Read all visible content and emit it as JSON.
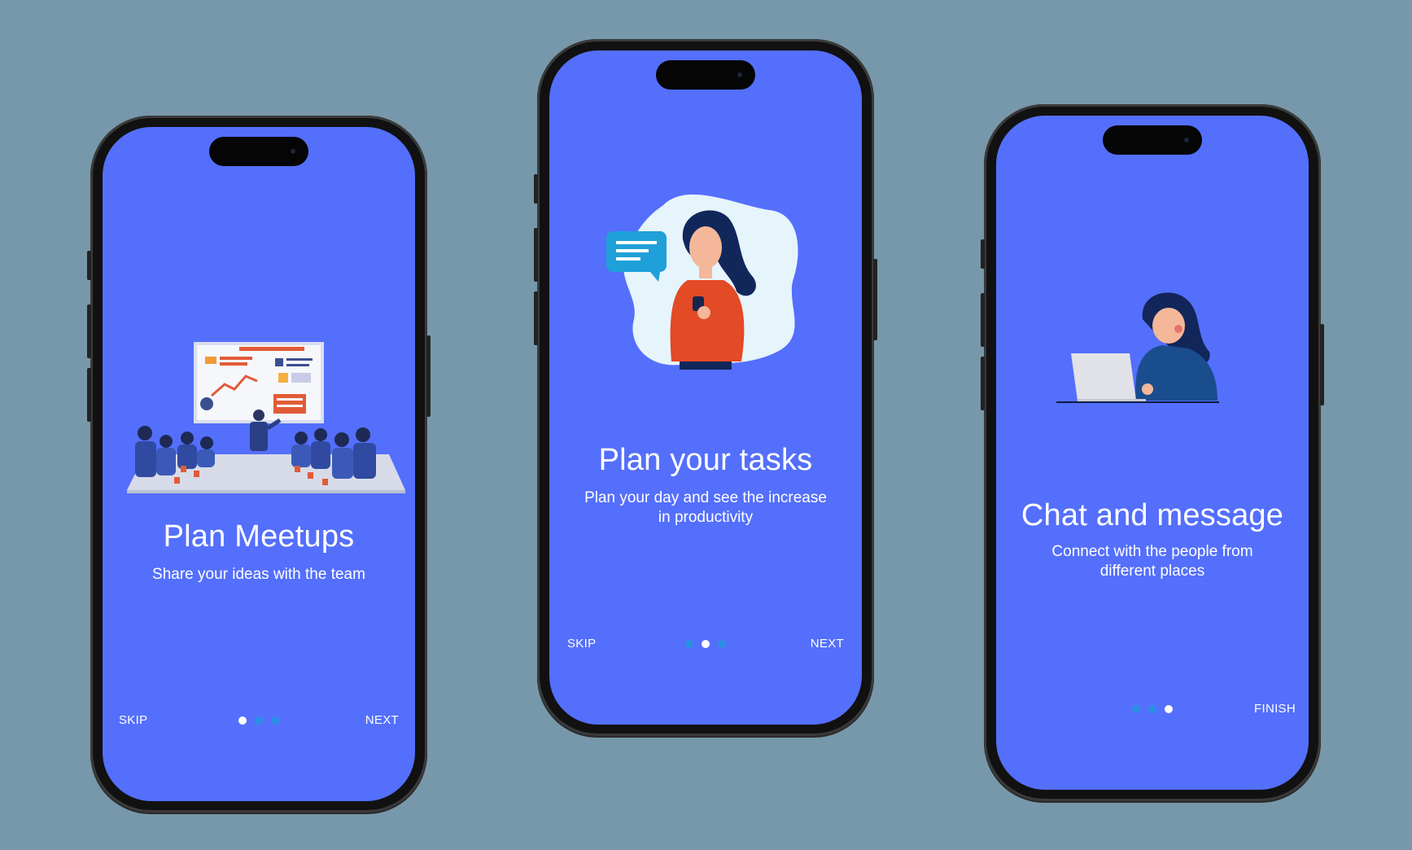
{
  "colors": {
    "background": "#7798aa",
    "screen": "#546ffc",
    "dot_active": "#ffffff",
    "dot_inactive": "#2c8fe6"
  },
  "screens": [
    {
      "title": "Plan Meetups",
      "subtitle": "Share your ideas with the team",
      "skip_label": "SKIP",
      "next_label": "NEXT",
      "active_page": 1,
      "page_count": 3,
      "illustration": "team-meeting-illustration"
    },
    {
      "title": "Plan your tasks",
      "subtitle": "Plan your day and see the increase in productivity",
      "skip_label": "SKIP",
      "next_label": "NEXT",
      "active_page": 2,
      "page_count": 3,
      "illustration": "woman-phone-chat-illustration"
    },
    {
      "title": "Chat and message",
      "subtitle": "Connect with the people from different places",
      "finish_label": "FINISH",
      "active_page": 3,
      "page_count": 3,
      "illustration": "woman-laptop-call-illustration"
    }
  ]
}
